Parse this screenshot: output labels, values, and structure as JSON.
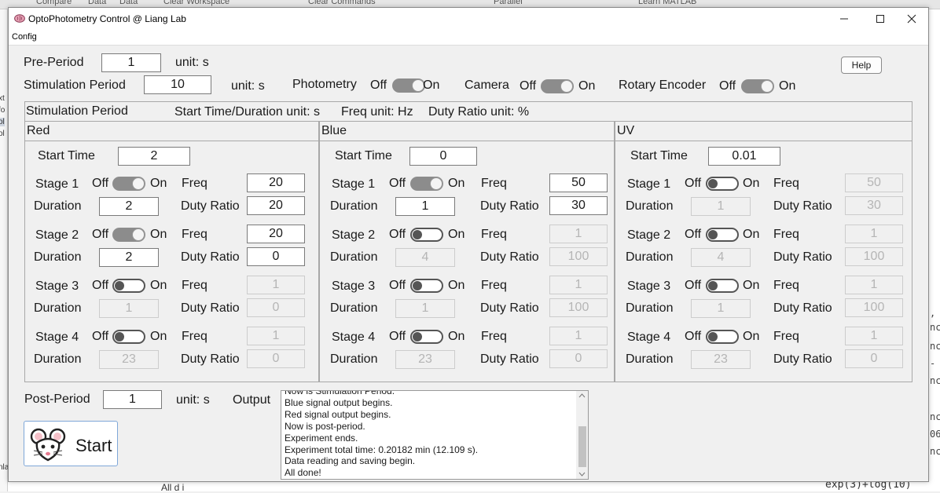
{
  "colors": {
    "title_bar": "#ffffff",
    "window_bg": "#f0f0f0",
    "field_border": "#7a7a7a",
    "disabled_text": "#b5b5b5",
    "toggle_on": "#8c8c8c",
    "start_border": "#7fa7d8"
  },
  "background_desktop": {
    "toolbar_items": [
      "Compare",
      "Data",
      "Data",
      "Clear Workspace",
      "Clear Commands",
      "Parallel",
      "Learn MATLAB"
    ],
    "left_fragments": [
      "xt",
      "fo",
      "ol",
      "ol",
      "nla"
    ],
    "right_fragments": [
      ",",
      "nc",
      "nc",
      "-",
      "nc",
      "nc",
      "06",
      "nc"
    ],
    "bottom_left_text": "All d    i",
    "cmd_tail": "exp(3)+log(10)"
  },
  "window": {
    "title": "OptoPhotometry Control @ Liang Lab",
    "app_icon": "brain-icon",
    "controls": {
      "minimize": "minimize-icon",
      "maximize": "maximize-icon",
      "close": "close-icon"
    },
    "menu": [
      "Config"
    ]
  },
  "top": {
    "pre_period": {
      "label": "Pre-Period",
      "value": "1",
      "unit": "unit: s"
    },
    "stim_period": {
      "label": "Stimulation Period",
      "value": "10",
      "unit": "unit: s"
    },
    "photometry": {
      "label": "Photometry",
      "off": "Off",
      "on": "On",
      "state": "on"
    },
    "camera": {
      "label": "Camera",
      "off": "Off",
      "on": "On",
      "state": "on"
    },
    "rotary": {
      "label": "Rotary Encoder",
      "off": "Off",
      "on": "On",
      "state": "on"
    },
    "help_label": "Help"
  },
  "stim_panel": {
    "title": "Stimulation Period",
    "unit_start": "Start Time/Duration unit: s",
    "unit_freq": "Freq unit: Hz",
    "unit_duty": "Duty Ratio unit: %",
    "labels": {
      "start_time": "Start Time",
      "freq": "Freq",
      "duration": "Duration",
      "duty": "Duty Ratio",
      "off": "Off",
      "on": "On"
    },
    "channels": [
      {
        "name": "Red",
        "start_time": "2",
        "stages": [
          {
            "name": "Stage 1",
            "state": "on",
            "freq": "20",
            "duration": "2",
            "duty": "20",
            "enabled": true
          },
          {
            "name": "Stage 2",
            "state": "on",
            "freq": "20",
            "duration": "2",
            "duty": "0",
            "enabled": true
          },
          {
            "name": "Stage 3",
            "state": "off",
            "freq": "1",
            "duration": "1",
            "duty": "0",
            "enabled": false
          },
          {
            "name": "Stage 4",
            "state": "off",
            "freq": "1",
            "duration": "23",
            "duty": "0",
            "enabled": false
          }
        ]
      },
      {
        "name": "Blue",
        "start_time": "0",
        "stages": [
          {
            "name": "Stage 1",
            "state": "on",
            "freq": "50",
            "duration": "1",
            "duty": "30",
            "enabled": true
          },
          {
            "name": "Stage 2",
            "state": "off",
            "freq": "1",
            "duration": "4",
            "duty": "100",
            "enabled": false
          },
          {
            "name": "Stage 3",
            "state": "off",
            "freq": "1",
            "duration": "1",
            "duty": "100",
            "enabled": false
          },
          {
            "name": "Stage 4",
            "state": "off",
            "freq": "1",
            "duration": "23",
            "duty": "0",
            "enabled": false
          }
        ]
      },
      {
        "name": "UV",
        "start_time": "0.01",
        "stages": [
          {
            "name": "Stage 1",
            "state": "off",
            "freq": "50",
            "duration": "1",
            "duty": "30",
            "enabled": false
          },
          {
            "name": "Stage 2",
            "state": "off",
            "freq": "1",
            "duration": "4",
            "duty": "100",
            "enabled": false
          },
          {
            "name": "Stage 3",
            "state": "off",
            "freq": "1",
            "duration": "1",
            "duty": "100",
            "enabled": false
          },
          {
            "name": "Stage 4",
            "state": "off",
            "freq": "1",
            "duration": "23",
            "duty": "0",
            "enabled": false
          }
        ]
      }
    ]
  },
  "bottom": {
    "post_period": {
      "label": "Post-Period",
      "value": "1",
      "unit": "unit: s"
    },
    "output_label": "Output",
    "output_lines": [
      "Now is Stimulation Period.",
      "Blue signal output begins.",
      "Red signal output begins.",
      "Now is post-period.",
      "Experiment ends.",
      "Experiment total time: 0.20182 min (12.109 s).",
      "Data reading and saving begin.",
      "All done!"
    ],
    "start_label": "Start",
    "start_icon": "mouse-icon"
  }
}
